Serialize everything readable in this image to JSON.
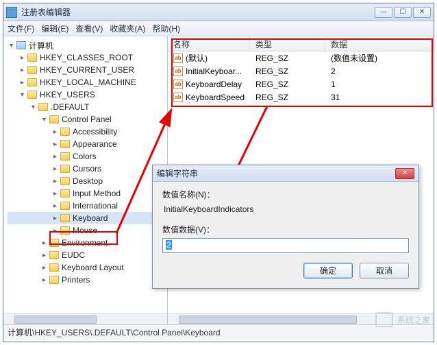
{
  "window": {
    "title": "注册表编辑器"
  },
  "menu": {
    "file": "文件(F)",
    "edit": "编辑(E)",
    "view": "查看(V)",
    "favorites": "收藏夹(A)",
    "help": "帮助(H)"
  },
  "tree": {
    "root": "计算机",
    "hkcr": "HKEY_CLASSES_ROOT",
    "hkcu": "HKEY_CURRENT_USER",
    "hklm": "HKEY_LOCAL_MACHINE",
    "hku": "HKEY_USERS",
    "default": ".DEFAULT",
    "cp": "Control Panel",
    "items": {
      "accessibility": "Accessibility",
      "appearance": "Appearance",
      "colors": "Colors",
      "cursors": "Cursors",
      "desktop": "Desktop",
      "input_method": "Input Method",
      "international": "International",
      "keyboard": "Keyboard",
      "mouse": "Mouse"
    },
    "environment": "Environment",
    "eudc": "EUDC",
    "keyboard_layout": "Keyboard Layout",
    "printers": "Printers"
  },
  "list": {
    "col_name": "名称",
    "col_type": "类型",
    "col_data": "数据",
    "rows": [
      {
        "name": "(默认)",
        "type": "REG_SZ",
        "data": "(数值未设置)"
      },
      {
        "name": "InitialKeyboar...",
        "type": "REG_SZ",
        "data": "2"
      },
      {
        "name": "KeyboardDelay",
        "type": "REG_SZ",
        "data": "1"
      },
      {
        "name": "KeyboardSpeed",
        "type": "REG_SZ",
        "data": "31"
      }
    ]
  },
  "dialog": {
    "title": "编辑字符串",
    "name_label": "数值名称(N)：",
    "name_value": "InitialKeyboardIndicators",
    "data_label": "数值数据(V)：",
    "data_value": "2",
    "ok": "确定",
    "cancel": "取消"
  },
  "statusbar": {
    "path": "计算机\\HKEY_USERS\\.DEFAULT\\Control Panel\\Keyboard"
  },
  "watermark": {
    "text": "系统之家"
  }
}
